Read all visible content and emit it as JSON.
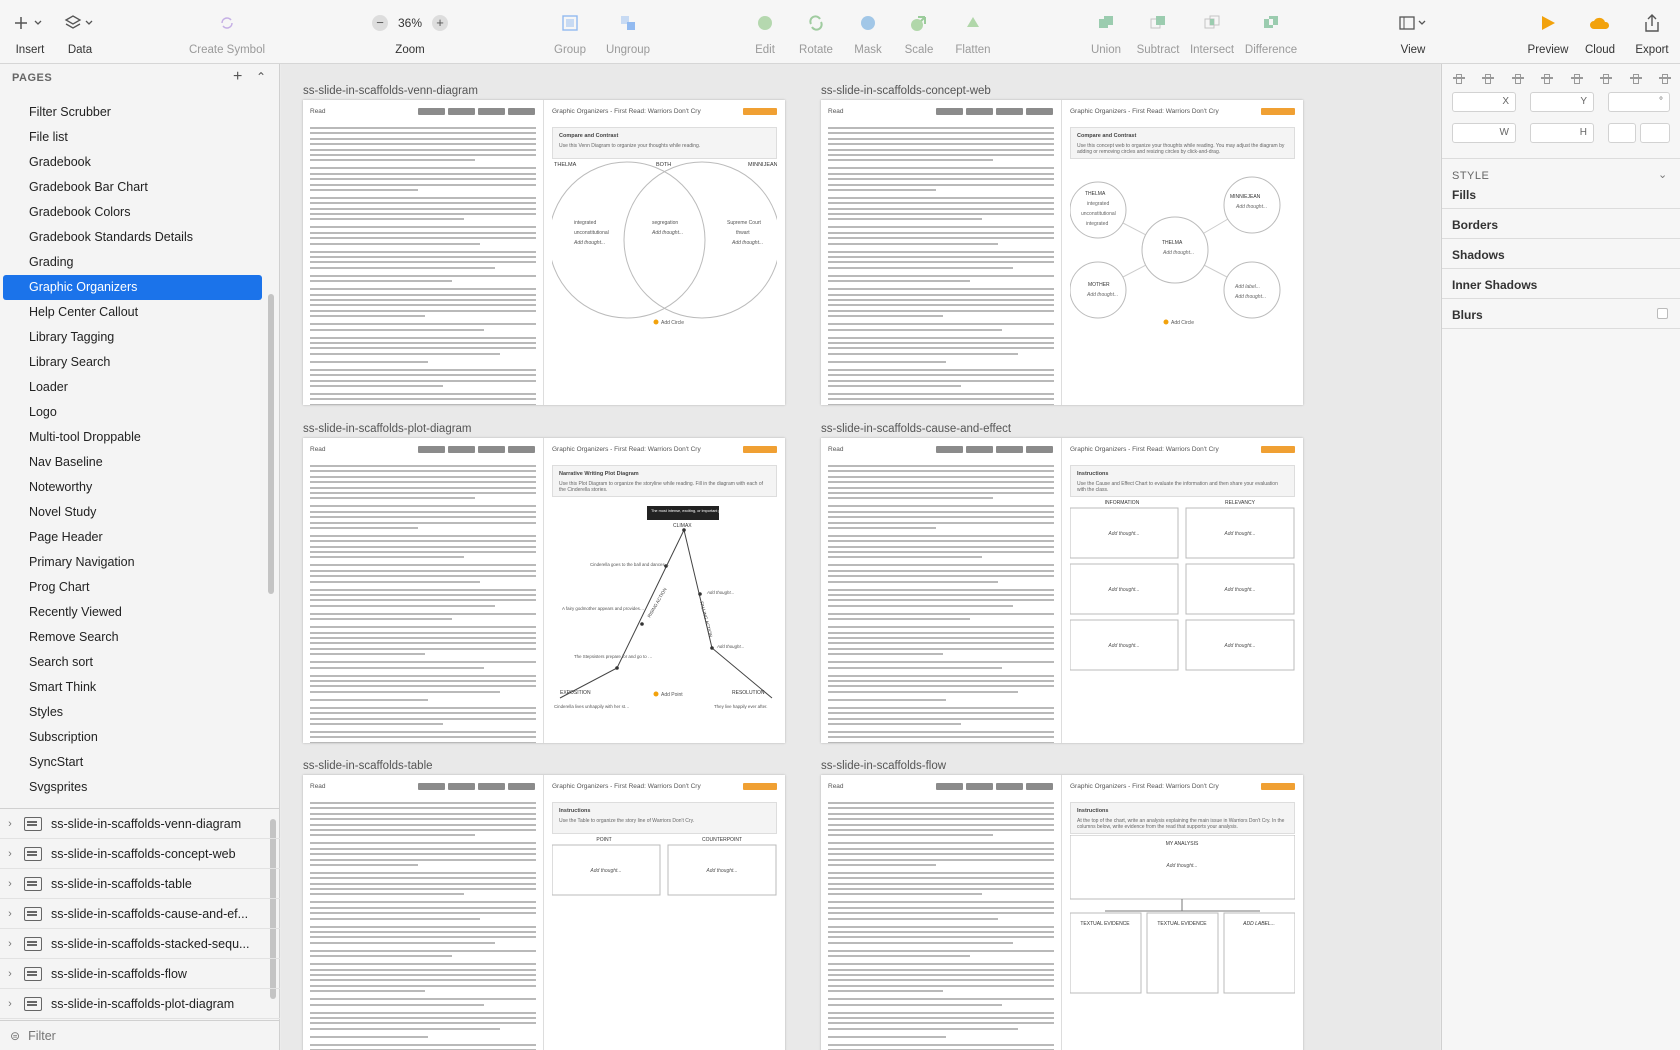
{
  "toolbar": {
    "insert": "Insert",
    "data": "Data",
    "create_symbol": "Create Symbol",
    "zoom_value": "36%",
    "zoom": "Zoom",
    "group": "Group",
    "ungroup": "Ungroup",
    "edit": "Edit",
    "rotate": "Rotate",
    "mask": "Mask",
    "scale": "Scale",
    "flatten": "Flatten",
    "union": "Union",
    "subtract": "Subtract",
    "intersect": "Intersect",
    "difference": "Difference",
    "view": "View",
    "preview": "Preview",
    "cloud": "Cloud",
    "export": "Export",
    "colors": {
      "preview": "#f2a20c",
      "cloud": "#f2a20c",
      "accent": "#1b73ea"
    }
  },
  "sidebar": {
    "pages_header": "PAGES",
    "pages": [
      "Filter Scrubber",
      "File list",
      "Gradebook",
      "Gradebook Bar Chart",
      "Gradebook Colors",
      "Gradebook Standards Details",
      "Grading",
      "Graphic Organizers",
      "Help Center Callout",
      "Library Tagging",
      "Library Search",
      "Loader",
      "Logo",
      "Multi-tool Droppable",
      "Nav Baseline",
      "Noteworthy",
      "Novel Study",
      "Page Header",
      "Primary Navigation",
      "Prog Chart",
      "Recently Viewed",
      "Remove Search",
      "Search sort",
      "Smart Think",
      "Styles",
      "Subscription",
      "SyncStart",
      "Svgsprites"
    ],
    "selected_page": "Graphic Organizers",
    "layers": [
      "ss-slide-in-scaffolds-venn-diagram",
      "ss-slide-in-scaffolds-concept-web",
      "ss-slide-in-scaffolds-table",
      "ss-slide-in-scaffolds-cause-and-ef...",
      "ss-slide-in-scaffolds-stacked-sequ...",
      "ss-slide-in-scaffolds-flow",
      "ss-slide-in-scaffolds-plot-diagram"
    ],
    "filter_placeholder": "Filter"
  },
  "artboards": [
    {
      "title": "ss-slide-in-scaffolds-venn-diagram",
      "read": "Read",
      "header": "Graphic Organizers - First Read: Warriors Don't Cry",
      "instr_title": "Compare and Contrast",
      "instr_text": "Use this Venn Diagram to organize your thoughts while reading.",
      "labels": [
        "THELMA",
        "BOTH",
        "MINNIJEAN"
      ],
      "items": [
        "integrated",
        "unconstitutional",
        "Add thought...",
        "segregation",
        "Add thought...",
        "Supreme Court",
        "thwart",
        "Add thought..."
      ],
      "add": "Add Circle"
    },
    {
      "title": "ss-slide-in-scaffolds-concept-web",
      "read": "Read",
      "header": "Graphic Organizers - First Read: Warriors Don't Cry",
      "instr_title": "Compare and Contrast",
      "instr_text": "Use this concept web to organize your thoughts while reading. You may adjust the diagram by adding or removing circles and resizing circles by click-and-drag.",
      "nodes": [
        "THELMA",
        "integrated",
        "unconstitutional",
        "integrated",
        "MINNIEJEAN",
        "Add thought...",
        "THELMA",
        "Add thought...",
        "MOTHER",
        "Add thought...",
        "Add label...",
        "Add thought..."
      ],
      "add": "Add Circle"
    },
    {
      "title": "ss-slide-in-scaffolds-plot-diagram",
      "read": "Read",
      "header": "Graphic Organizers - First Read: Warriors Don't Cry",
      "instr_title": "Narrative Writing Plot Diagram",
      "instr_text": "Use this Plot Diagram to organize the storyline while reading. Fill in the diagram with each of the Cinderella stories.",
      "climax": "CLIMAX",
      "tooltip": "The most intense, exciting, or important point of a story",
      "rising": "RISING ACTION",
      "falling": "FALLING ACTION",
      "exposition": "EXPOSITION",
      "resolution": "RESOLUTION",
      "points": [
        "Cinderella goes to the ball and dances with the prince",
        "A fairy godmother appears and provides Cinderella with clothes, coach, and footmen.",
        "The Stepsisters prepare for and go to the ball",
        "Cinderella lives unhappily with her stepsisters and their mother.",
        "Add thought...",
        "Add thought...",
        "They live happily ever after."
      ],
      "add": "Add Point"
    },
    {
      "title": "ss-slide-in-scaffolds-cause-and-effect",
      "read": "Read",
      "header": "Graphic Organizers - First Read: Warriors Don't Cry",
      "instr_title": "Instructions",
      "instr_text": "Use the Cause and Effect Chart to evaluate the information and then share your evaluation with the class.",
      "cols": [
        "INFORMATION",
        "RELEVANCY"
      ],
      "cell": "Add thought..."
    },
    {
      "title": "ss-slide-in-scaffolds-table",
      "read": "Read",
      "header": "Graphic Organizers - First Read: Warriors Don't Cry",
      "instr_title": "Instructions",
      "instr_text": "Use the Table to organize the story line of Warriors Don't Cry.",
      "cols": [
        "POINT",
        "COUNTERPOINT"
      ],
      "cell": "Add thought..."
    },
    {
      "title": "ss-slide-in-scaffolds-flow",
      "read": "Read",
      "header": "Graphic Organizers - First Read: Warriors Don't Cry",
      "instr_title": "Instructions",
      "instr_text": "At the top of the chart, write an analysis explaining the main issue in Warriors Don't Cry. In the columns below, write evidence from the read that supports your analysis.",
      "analysis": "MY ANALYSIS",
      "cell": "Add thought...",
      "cols": [
        "TEXTUAL EVIDENCE",
        "TEXTUAL EVIDENCE",
        "ADD LABEL..."
      ]
    }
  ],
  "inspector": {
    "x": "X",
    "y": "Y",
    "rot": "°",
    "w": "W",
    "h": "H",
    "style": "STYLE",
    "sections": [
      "Fills",
      "Borders",
      "Shadows",
      "Inner Shadows",
      "Blurs"
    ]
  }
}
